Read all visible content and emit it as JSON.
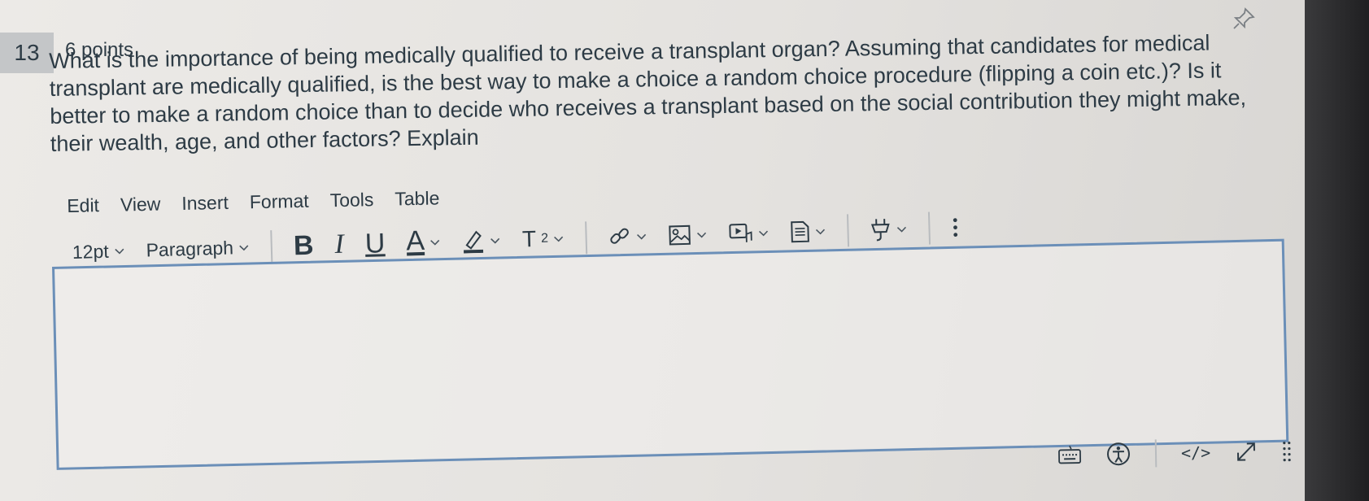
{
  "question": {
    "number": "13",
    "points": "6 points",
    "text": "What is the importance of being medically qualified to receive a transplant organ?  Assuming that candidates for medical transplant are medically qualified, is the best way to make a choice a random choice procedure (flipping a coin etc.)?  Is it better to make a random choice than to decide who receives a transplant based on the social contribution they might make, their wealth, age, and other factors? Explain"
  },
  "menu": [
    "Edit",
    "View",
    "Insert",
    "Format",
    "Tools",
    "Table"
  ],
  "toolbar": {
    "font_size": "12pt",
    "block_format": "Paragraph",
    "bold": "B",
    "italic": "I",
    "underline": "U",
    "text_color": "A",
    "superscript": "T",
    "superscript_exp": "2"
  },
  "editor": {
    "value": ""
  },
  "statusbar": {
    "html_editor": "</>"
  },
  "colors": {
    "accent": "#6b8fb8",
    "text": "#2d3b45"
  }
}
